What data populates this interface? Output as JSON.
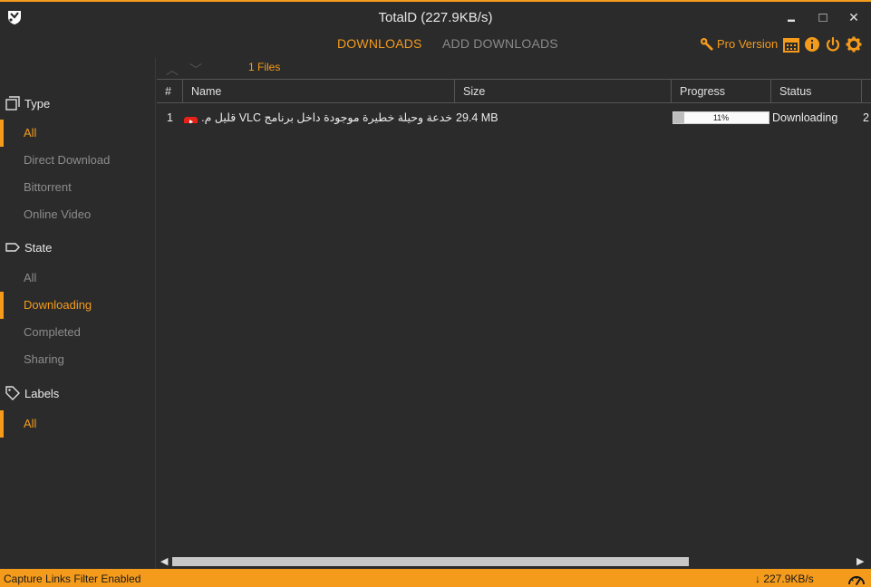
{
  "window": {
    "title": "TotalD (227.9KB/s)",
    "controls": {
      "minimize": "▬",
      "maximize": "□",
      "close": "✕"
    }
  },
  "nav": {
    "tabs": [
      {
        "label": "DOWNLOADS",
        "active": true
      },
      {
        "label": "ADD DOWNLOADS",
        "active": false
      }
    ],
    "pro_label": "Pro Version",
    "tool_icons": [
      "wrench-icon",
      "calendar-icon",
      "info-icon",
      "power-icon",
      "gear-icon"
    ]
  },
  "sidebar": {
    "sections": [
      {
        "heading": "Type",
        "icon": "type-icon",
        "items": [
          {
            "label": "All",
            "active": true
          },
          {
            "label": "Direct Download",
            "active": false
          },
          {
            "label": "Bittorrent",
            "active": false
          },
          {
            "label": "Online Video",
            "active": false
          }
        ]
      },
      {
        "heading": "State",
        "icon": "tag-icon",
        "items": [
          {
            "label": "All",
            "active": false
          },
          {
            "label": "Downloading",
            "active": true
          },
          {
            "label": "Completed",
            "active": false
          },
          {
            "label": "Sharing",
            "active": false
          }
        ]
      },
      {
        "heading": "Labels",
        "icon": "label-icon",
        "items": [
          {
            "label": "All",
            "active": true
          }
        ]
      }
    ]
  },
  "main": {
    "files_count": "1 Files",
    "columns": [
      "#",
      "Name",
      "Size",
      "Progress",
      "Status"
    ],
    "rows": [
      {
        "index": "1",
        "name": "خدعة وحيلة خطيرة موجودة داخل برنامج VLC قليل م... 15",
        "size": "29.4 MB",
        "progress": 11,
        "progress_label": "11%",
        "status": "Downloading",
        "extra": "2"
      }
    ]
  },
  "statusbar": {
    "filter_text": "Capture Links Filter Enabled",
    "speed": "↓ 227.9KB/s"
  },
  "colors": {
    "accent": "#f49b1c",
    "bg": "#2b2b2b",
    "muted": "#8d8d8d"
  }
}
